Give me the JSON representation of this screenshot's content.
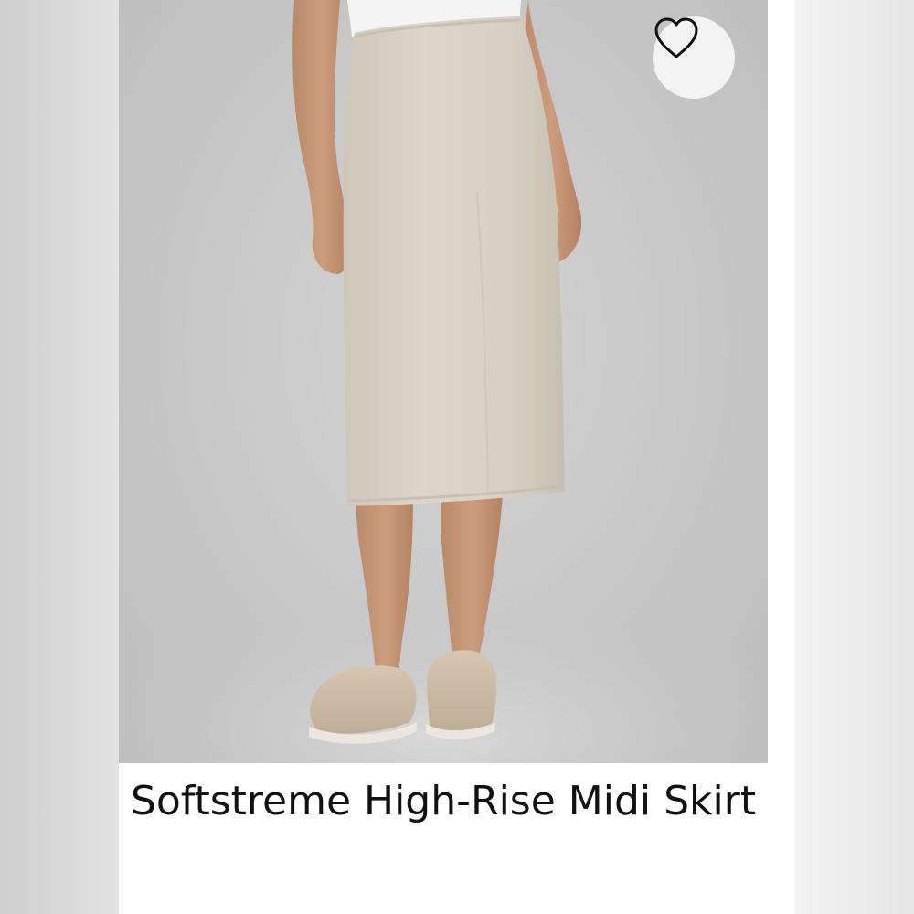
{
  "product": {
    "title": "Softstreme High-Rise Midi Skirt",
    "image_alt": "Model wearing beige midi skirt and beige clog shoes",
    "favorite_icon": "heart-outline-icon"
  },
  "colors": {
    "skirt": "#d9d1c6",
    "background": "#c9c9c9",
    "card": "#ffffff",
    "title_text": "#111111"
  }
}
